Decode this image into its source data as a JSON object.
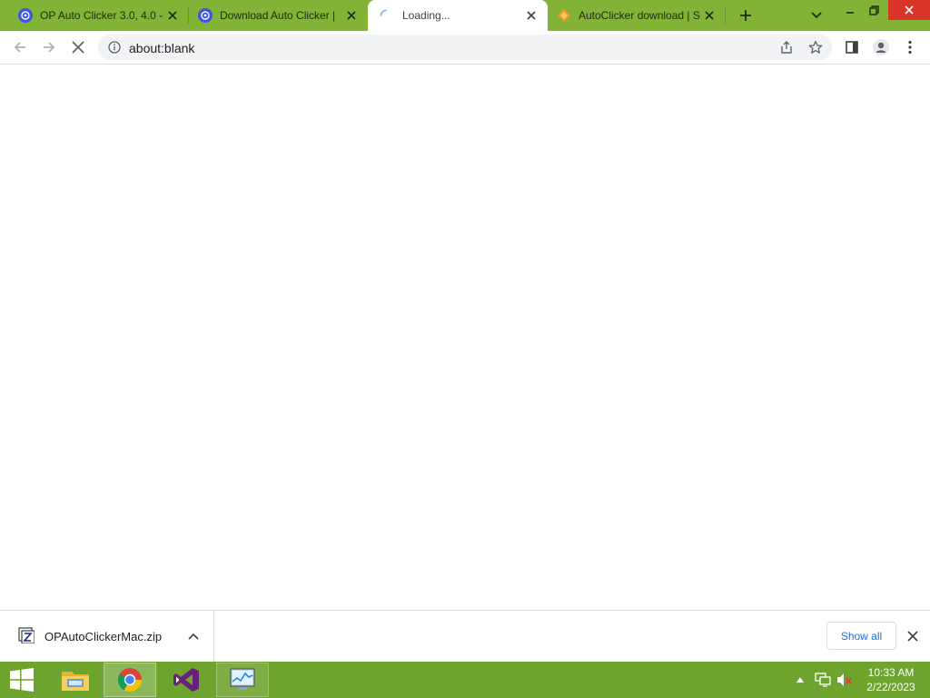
{
  "browser": {
    "accent_color": "#82b236",
    "tabs": [
      {
        "title": "OP Auto Clicker 3.0, 4.0 -",
        "favicon": "op-autoclicker-favicon",
        "active": false
      },
      {
        "title": "Download Auto Clicker |",
        "favicon": "op-autoclicker-favicon",
        "active": false
      },
      {
        "title": "Loading...",
        "favicon": "loading-spinner-icon",
        "active": true
      },
      {
        "title": "AutoClicker download | S",
        "favicon": "softonic-favicon",
        "active": false
      }
    ],
    "new_tab_icon": "plus-icon",
    "tab_search_icon": "chevron-down-icon",
    "window_controls": [
      "minimize-icon",
      "restore-icon",
      "close-icon"
    ],
    "toolbar": {
      "url": "about:blank",
      "back_icon": "back-arrow-icon",
      "forward_icon": "forward-arrow-icon",
      "stop_icon": "stop-icon",
      "info_icon": "info-icon",
      "share_icon": "share-icon",
      "bookmark_icon": "star-icon",
      "side_panel_icon": "side-panel-icon",
      "profile_icon": "profile-icon",
      "menu_icon": "kebab-menu-icon"
    }
  },
  "download_shelf": {
    "file_name": "OPAutoClickerMac.zip",
    "file_icon": "zip-file-icon",
    "options_icon": "chevron-up-icon",
    "show_all_label": "Show all",
    "close_icon": "close-icon"
  },
  "taskbar": {
    "background_color": "#6ea32e",
    "start_icon": "windows-logo-icon",
    "apps": [
      {
        "name": "file-explorer-icon",
        "state": "pinned"
      },
      {
        "name": "chrome-icon",
        "state": "active"
      },
      {
        "name": "visual-studio-icon",
        "state": "pinned"
      },
      {
        "name": "task-manager-icon",
        "state": "running"
      }
    ],
    "tray": [
      "tray-expand-icon",
      "network-icon",
      "volume-muted-icon"
    ],
    "clock": {
      "time": "10:33 AM",
      "date": "2/22/2023"
    }
  }
}
